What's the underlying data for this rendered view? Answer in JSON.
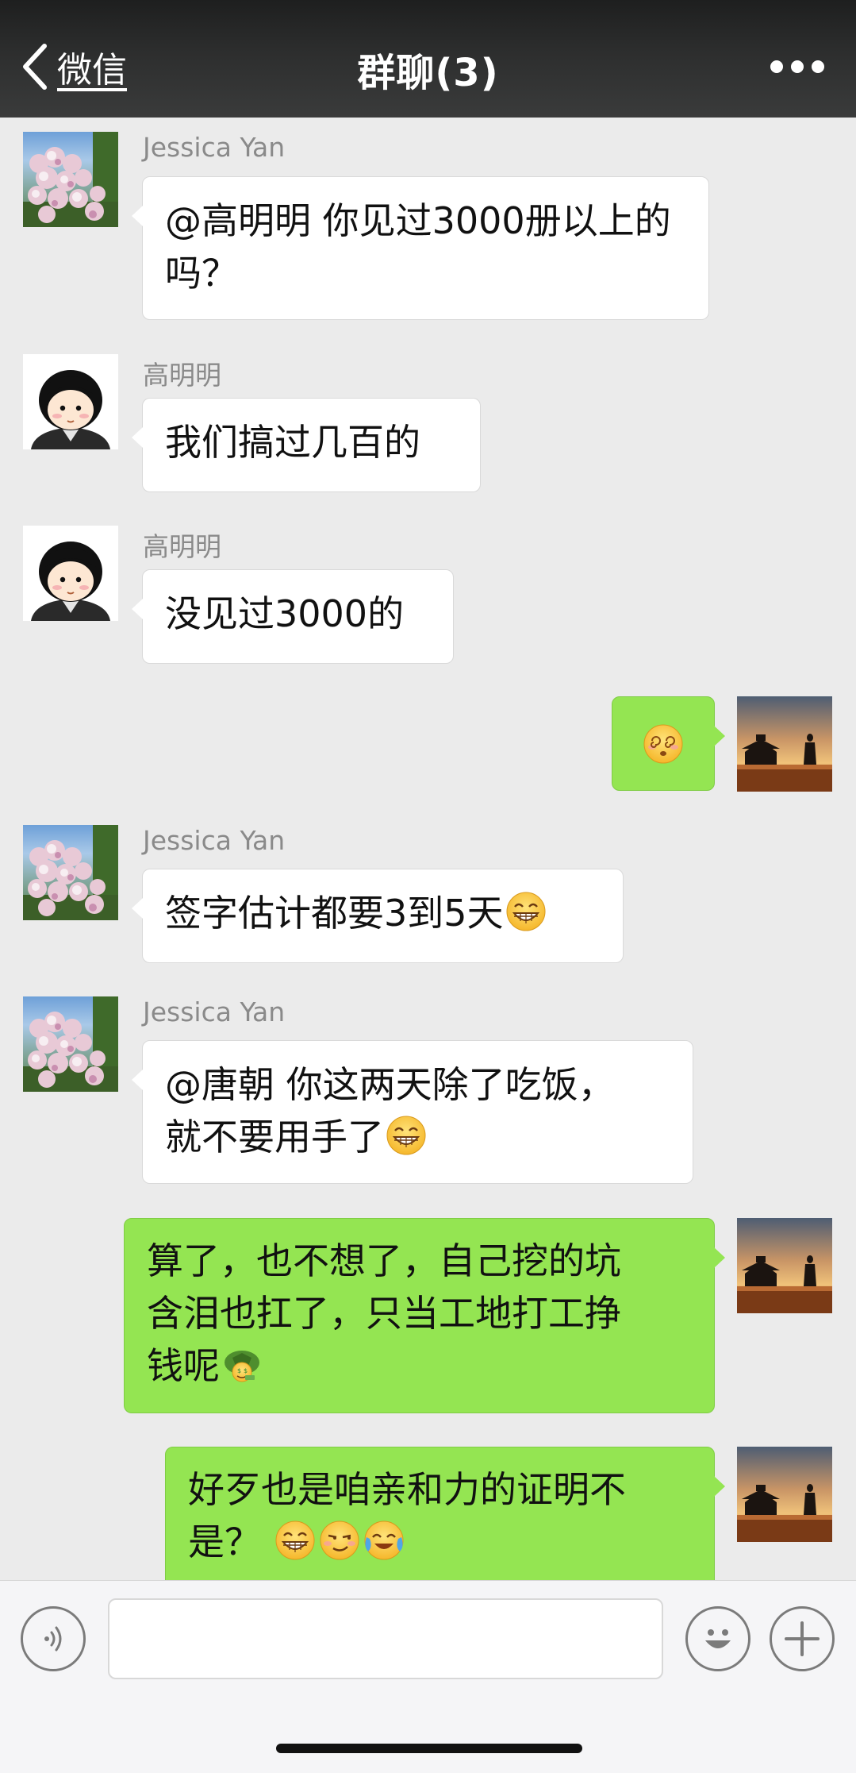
{
  "header": {
    "back_label": "微信",
    "title": "群聊(3)"
  },
  "messages": [
    {
      "sender": "Jessica Yan",
      "text": "@高明明 你见过3000册以上的吗？",
      "avatar": "hydrangea-avatar"
    },
    {
      "sender": "高明明",
      "text": "我们搞过几百的",
      "avatar": "cartoon-girl-avatar"
    },
    {
      "sender": "高明明",
      "text": "没见过3000的",
      "avatar": "cartoon-girl-avatar"
    },
    {
      "sender": "",
      "text": "",
      "emoji": "dizzy-face-emoji",
      "avatar": "sunset-figure-avatar",
      "outgoing": true
    },
    {
      "sender": "Jessica Yan",
      "text": "签字估计都要3到5天",
      "emoji": "grin-emoji",
      "avatar": "hydrangea-avatar"
    },
    {
      "sender": "Jessica Yan",
      "text_line1": "@唐朝 你这两天除了吃饭，",
      "text_line2": "就不要用手了",
      "emoji": "grin-emoji",
      "avatar": "hydrangea-avatar"
    },
    {
      "text_line1": "算了，也不想了，自己挖的坑",
      "text_line2": "含泪也扛了，只当工地打工挣",
      "text_line3": "钱呢",
      "emoji": "money-turtle-emoji",
      "avatar": "sunset-figure-avatar",
      "outgoing": true
    },
    {
      "text_line1": "好歹也是咱亲和力的证明不",
      "text_line2": "是？",
      "emojis": [
        "grin-emoji",
        "smirk-emoji",
        "crying-laughing-emoji"
      ],
      "avatar": "sunset-figure-avatar",
      "outgoing": true
    }
  ],
  "input": {
    "value": ""
  },
  "colors": {
    "header_bg": "#2d2e2e",
    "chat_bg": "#ebebeb",
    "incoming_bubble": "#ffffff",
    "outgoing_bubble": "#94e552"
  }
}
